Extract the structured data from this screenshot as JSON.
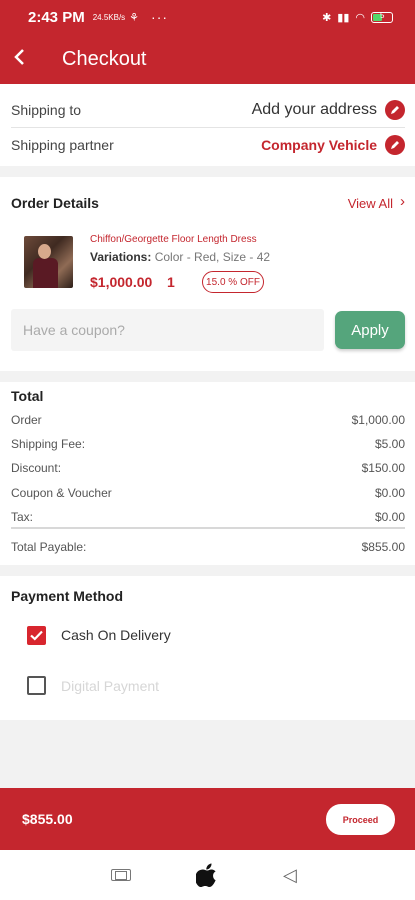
{
  "status_bar": {
    "time": "2:43 PM",
    "net_speed": "24.5KB/s",
    "dots": "···",
    "battery_text": "5"
  },
  "app_bar": {
    "title": "Checkout",
    "back_icon": "‹"
  },
  "shipping": {
    "to_label": "Shipping to",
    "to_value": "Add your address",
    "partner_label": "Shipping partner",
    "partner_value": "Company Vehicle"
  },
  "order": {
    "heading": "Order Details",
    "view_all": "View All",
    "product": {
      "name": "Chiffon/Georgette Floor Length Dress",
      "variations_label": "Variations:",
      "variations_value": "Color - Red,  Size - 42",
      "price": "$1,000.00",
      "qty": "1",
      "discount": "15.0 % OFF"
    },
    "coupon_placeholder": "Have a coupon?",
    "apply_label": "Apply"
  },
  "totals": {
    "heading": "Total",
    "rows": [
      {
        "label": "Order",
        "amount": "$1,000.00"
      },
      {
        "label": "Shipping Fee:",
        "amount": "$5.00"
      },
      {
        "label": "Discount:",
        "amount": "$150.00"
      },
      {
        "label": "Coupon & Voucher",
        "amount": "$0.00"
      },
      {
        "label": "Tax:",
        "amount": "$0.00"
      }
    ],
    "payable_label": "Total Payable:",
    "payable_amount": "$855.00"
  },
  "payment": {
    "heading": "Payment Method",
    "options": [
      {
        "label": "Cash On Delivery",
        "checked": true
      },
      {
        "label": "Digital Payment",
        "checked": false
      }
    ]
  },
  "bottom": {
    "total": "$855.00",
    "proceed_label": "Proceed"
  },
  "colors": {
    "brand_red": "#c4262e",
    "apply_green": "#55a57c"
  }
}
